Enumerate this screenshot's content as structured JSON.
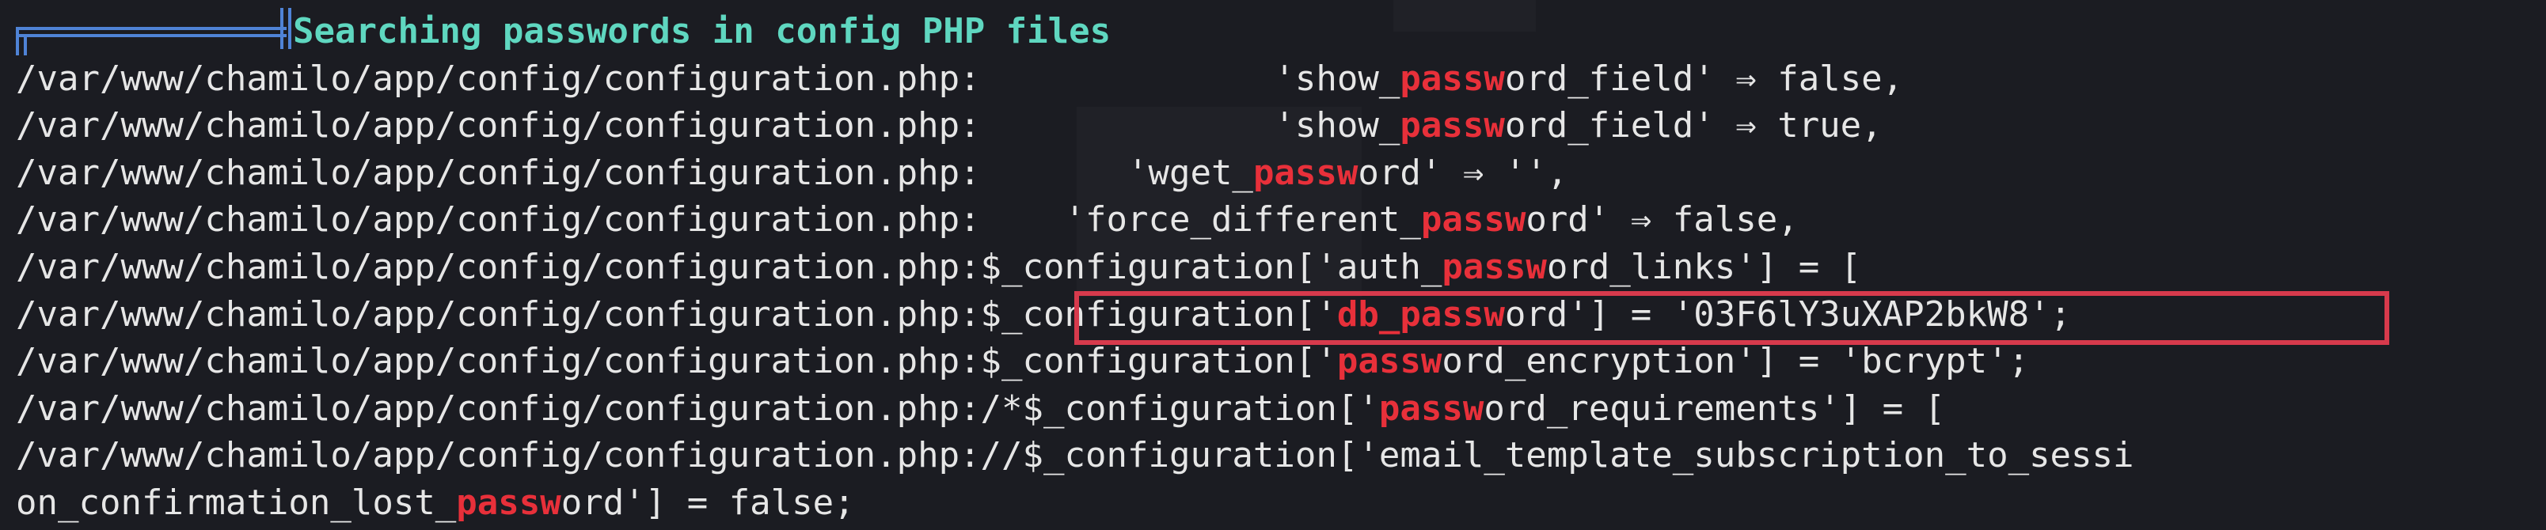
{
  "terminal": {
    "header_text": "Searching passwords in config PHP files",
    "highlight_color": "#e8303a",
    "accent_color": "#5fd7c0",
    "lines": [
      {
        "segments": [
          "/var/www/chamilo/app/config/configuration.php:              'show_",
          "pass",
          "w",
          "ord_field' ⇒ false,"
        ]
      },
      {
        "segments": [
          "/var/www/chamilo/app/config/configuration.php:              'show_",
          "pass",
          "w",
          "ord_field' ⇒ true,"
        ]
      },
      {
        "segments": [
          "/var/www/chamilo/app/config/configuration.php:       'wget_",
          "pass",
          "w",
          "ord' ⇒ '',"
        ]
      },
      {
        "segments": [
          "/var/www/chamilo/app/config/configuration.php:    'force_different_",
          "pass",
          "w",
          "ord' ⇒ false,"
        ]
      },
      {
        "segments": [
          "/var/www/chamilo/app/config/configuration.php:$_configuration['auth_",
          "pass",
          "w",
          "ord_links'] = ["
        ]
      },
      {
        "segments": [
          "/var/www/chamilo/app/config/configuration.php:$_configuration['",
          "db_pass",
          "w",
          "ord'] = '03F6lY3uXAP2bkW8';"
        ]
      },
      {
        "segments": [
          "/var/www/chamilo/app/config/configuration.php:$_configuration['",
          "pass",
          "w",
          "ord_encryption'] = 'bcrypt';"
        ]
      },
      {
        "segments": [
          "/var/www/chamilo/app/config/configuration.php:/*$_configuration['",
          "pass",
          "w",
          "ord_requirements'] = ["
        ]
      },
      {
        "segments": [
          "/var/www/chamilo/app/config/configuration.php://$_configuration['email_template_subscription_to_sessi",
          "",
          "",
          ""
        ]
      },
      {
        "segments": [
          "on_confirmation_lost_",
          "pass",
          "w",
          "ord'] = false;"
        ]
      }
    ]
  }
}
